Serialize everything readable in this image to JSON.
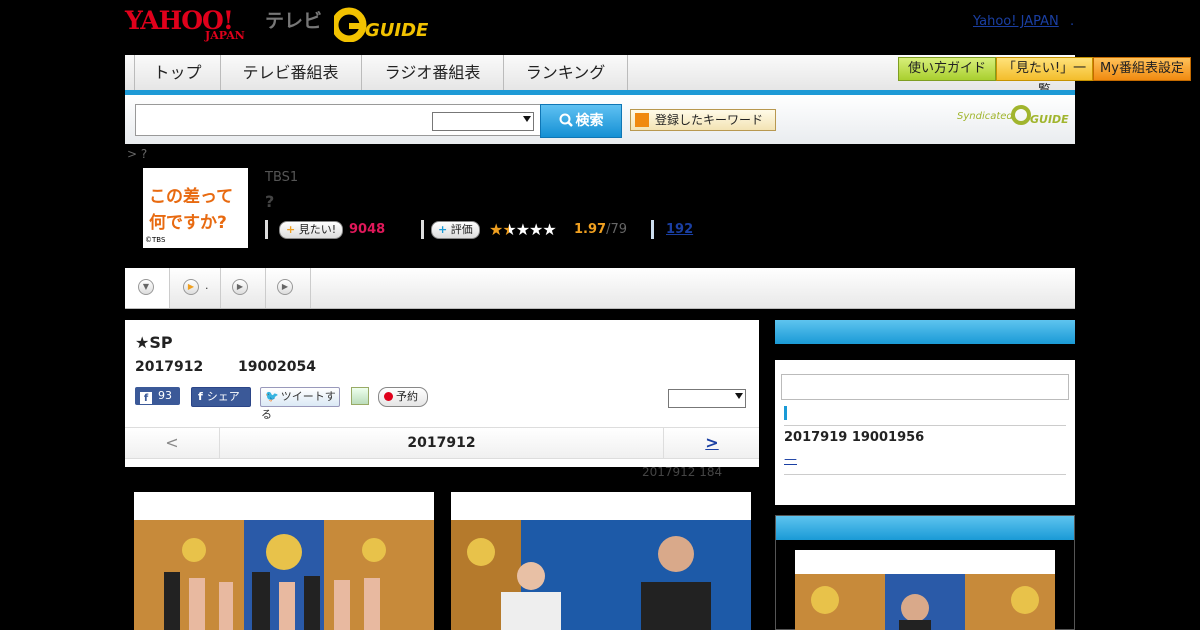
{
  "header": {
    "logo_yahoo": "YAHOO!",
    "logo_japan": "JAPAN",
    "logo_tv": "テレビ",
    "logo_gguide": "G GUIDE",
    "yahoo_japan_link": "Yahoo! JAPAN",
    "top_right_dot": "."
  },
  "nav": {
    "items": [
      "トップ",
      "テレビ番組表",
      "ラジオ番組表",
      "ランキング"
    ],
    "guide": "使い方ガイド",
    "mitai_list": "「見たい!」一覧",
    "my_schedule": "My番組表設定"
  },
  "search": {
    "button": "検索",
    "registered_keyword": "登録したキーワード",
    "syndicated": "Syndicated"
  },
  "breadcrumb": "> ?",
  "program": {
    "thumb_title": "この差って何ですか?",
    "thumb_copyright": "©TBS",
    "channel": "TBS1",
    "title": "?",
    "mitai_label": "見たい!",
    "mitai_count": "9048",
    "rate_label": "評価",
    "rating": "1.97",
    "rating_total": "/79",
    "review_count": "192",
    "rating_value": 1.97
  },
  "main": {
    "title": "★SP",
    "date": "2017912",
    "time": "19002054",
    "fb_count": "93",
    "fb_share": "シェア",
    "tweet": "ツイートする",
    "reserve": "予約",
    "pager_prev": "<",
    "pager_current": "2017912",
    "pager_next": ">",
    "photo_meta": "2017912  184"
  },
  "sidebar": {
    "date": "2017919  19001956",
    "link": "—"
  }
}
